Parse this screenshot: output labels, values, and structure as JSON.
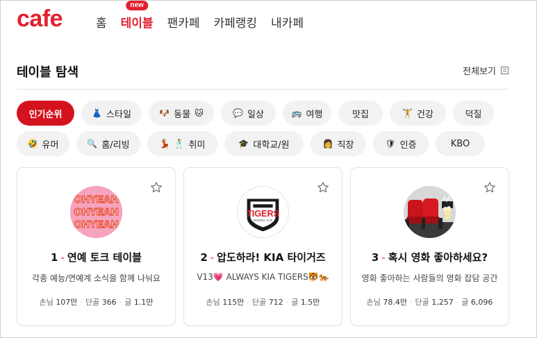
{
  "header": {
    "logo": "cafe",
    "nav": [
      {
        "label": "홈",
        "active": false
      },
      {
        "label": "테이블",
        "active": true,
        "badge": "new"
      },
      {
        "label": "팬카페",
        "active": false
      },
      {
        "label": "카페랭킹",
        "active": false
      },
      {
        "label": "내카페",
        "active": false
      }
    ]
  },
  "section": {
    "title": "테이블 탐색",
    "view_all": "전체보기"
  },
  "chips": [
    {
      "label": "인기순위",
      "icon": "",
      "active": true
    },
    {
      "label": "스타일",
      "icon": "👗"
    },
    {
      "label": "동물",
      "icon": "🐶",
      "icon2": "🐱"
    },
    {
      "label": "일상",
      "icon": "💬"
    },
    {
      "label": "여행",
      "icon": "🚌"
    },
    {
      "label": "맛집",
      "icon": ""
    },
    {
      "label": "건강",
      "icon": "🏋"
    },
    {
      "label": "덕질",
      "icon": ""
    },
    {
      "label": "유머",
      "icon": "🤣"
    },
    {
      "label": "홈/리빙",
      "icon": "🔍"
    },
    {
      "label": "취미",
      "icon": "💃",
      "icon2": "🕺"
    },
    {
      "label": "대학교/원",
      "icon": "🎓"
    },
    {
      "label": "직장",
      "icon": "👩"
    },
    {
      "label": "인증",
      "icon": "🛡"
    },
    {
      "label": "KBO",
      "icon": ""
    }
  ],
  "cards": [
    {
      "rank": "1",
      "title": "연예 토크 테이블",
      "desc": "각종 예능/연예계 소식을 함께 나눠요",
      "stats": {
        "guests_label": "손님",
        "guests": "107만",
        "regulars_label": "단골",
        "regulars": "366",
        "posts_label": "글",
        "posts": "1.1만"
      },
      "thumb_text": "OHYEAH"
    },
    {
      "rank": "2",
      "title": "압도하라! KIA 타이거즈",
      "desc": "V13💗 ALWAYS KIA TIGERS🐯🐅",
      "stats": {
        "guests_label": "손님",
        "guests": "115만",
        "regulars_label": "단골",
        "regulars": "712",
        "posts_label": "글",
        "posts": "1.5만"
      },
      "thumb_text": "TIGERS",
      "thumb_sub": "BASEBALL CLUB"
    },
    {
      "rank": "3",
      "title": "혹시 영화 좋아하세요?",
      "desc": "영화 좋아하는 사람들의 영화 잡담 공간",
      "stats": {
        "guests_label": "손님",
        "guests": "78.4만",
        "regulars_label": "단골",
        "regulars": "1,257",
        "posts_label": "글",
        "posts": "6,096"
      }
    }
  ],
  "colors": {
    "brand": "#e4202f",
    "chip_active": "#d5131f",
    "chip": "#f2f2f2"
  }
}
